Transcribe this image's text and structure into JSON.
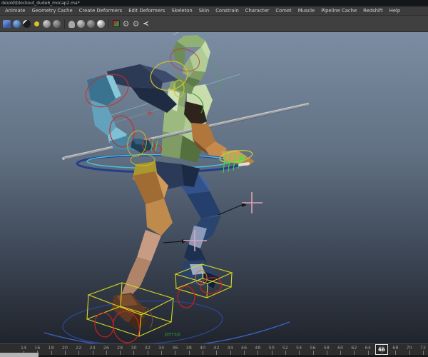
{
  "window": {
    "title": "de\\old\\blockout_dude6_mocap2.ma*"
  },
  "menu_bar": {
    "items": [
      "Animate",
      "Geometry Cache",
      "Create Deformers",
      "Edit Deformers",
      "Skeleton",
      "Skin",
      "Constrain",
      "Character",
      "Comet",
      "Muscle",
      "Pipeline Cache",
      "Redshift",
      "Help"
    ]
  },
  "toolbar": {
    "icons": [
      {
        "name": "wireframe-cube-icon",
        "type": "cube"
      },
      {
        "name": "shaded-sphere-icon",
        "type": "sphere-blue"
      },
      {
        "name": "textured-sphere-icon",
        "type": "sphere-checker"
      },
      {
        "name": "lights-icon",
        "type": "dot-yellow"
      },
      {
        "name": "shadows-sphere-icon",
        "type": "sphere-grey"
      },
      {
        "name": "ao-sphere-icon",
        "type": "sphere-grey-dim"
      },
      {
        "name": "separator",
        "type": "sep"
      },
      {
        "name": "lamp-icon",
        "type": "bell"
      },
      {
        "name": "render-sphere-icon-a",
        "type": "sphere-grey"
      },
      {
        "name": "render-sphere-icon-b",
        "type": "sphere-grey-dim"
      },
      {
        "name": "render-sphere-icon-c",
        "type": "sphere-grey-hi"
      },
      {
        "name": "separator",
        "type": "sep"
      },
      {
        "name": "xray-icon",
        "type": "xray"
      },
      {
        "name": "gear-icon-1",
        "type": "gear",
        "glyph": "⚙"
      },
      {
        "name": "gear-icon-2",
        "type": "gear",
        "glyph": "⚙"
      },
      {
        "name": "share-icon",
        "type": "share",
        "glyph": "≺"
      }
    ]
  },
  "viewport": {
    "camera_label": "persp",
    "scene": "low-poly blockout character in run pose holding a staff, animation rig controls visible",
    "colors": {
      "viewport_top": "#7b8da2",
      "viewport_bottom": "#20242c",
      "selection_green": "#3ce83c",
      "control_red": "#c23030",
      "control_yellow": "#d4c224",
      "foot_box_yellow": "#d6d622",
      "pole_vector_pink": "#dda4b4",
      "hip_control_cyan": "#45c0e0",
      "ground_circle_blue": "#2a4694",
      "motion_trail_blue": "#3b62c4",
      "staff_grey": "#9aa0a6",
      "left_arm_blue": "#62a2bc",
      "shoulder_navy": "#2d3a56",
      "right_arm_orange": "#c68a4c",
      "left_leg_orange": "#bf8a4c",
      "right_leg_blue": "#33528c",
      "torso_green": "#a9c890"
    }
  },
  "timeline": {
    "labels": [
      14,
      16,
      18,
      20,
      22,
      24,
      26,
      28,
      30,
      32,
      34,
      36,
      38,
      40,
      42,
      44,
      46,
      48,
      50,
      52,
      54,
      56,
      58,
      60,
      62,
      64,
      66,
      68,
      70,
      72
    ],
    "current_frame": 66
  }
}
